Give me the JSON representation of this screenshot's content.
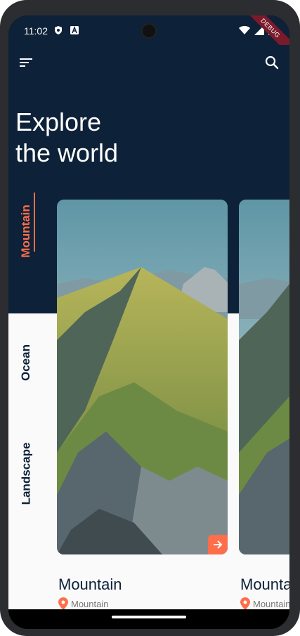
{
  "status_bar": {
    "time": "11:02",
    "debug_label": "DEBUG"
  },
  "header": {
    "title_line1": "Explore",
    "title_line2": "the world"
  },
  "tabs": [
    {
      "label": "Mountain",
      "active": true
    },
    {
      "label": "Ocean",
      "active": false
    },
    {
      "label": "Landscape",
      "active": false
    }
  ],
  "cards": [
    {
      "title": "Mountain",
      "location": "Mountain"
    },
    {
      "title": "Mountain",
      "location": "Mountain"
    }
  ],
  "colors": {
    "background": "#0d2138",
    "accent": "#ff6e4a",
    "surface": "#fafafa",
    "muted_text": "#777777"
  },
  "icons": [
    "menu-icon",
    "search-icon",
    "arrow-right-icon",
    "location-pin-icon",
    "shield-icon",
    "wifi-icon",
    "signal-icon",
    "battery-icon"
  ]
}
